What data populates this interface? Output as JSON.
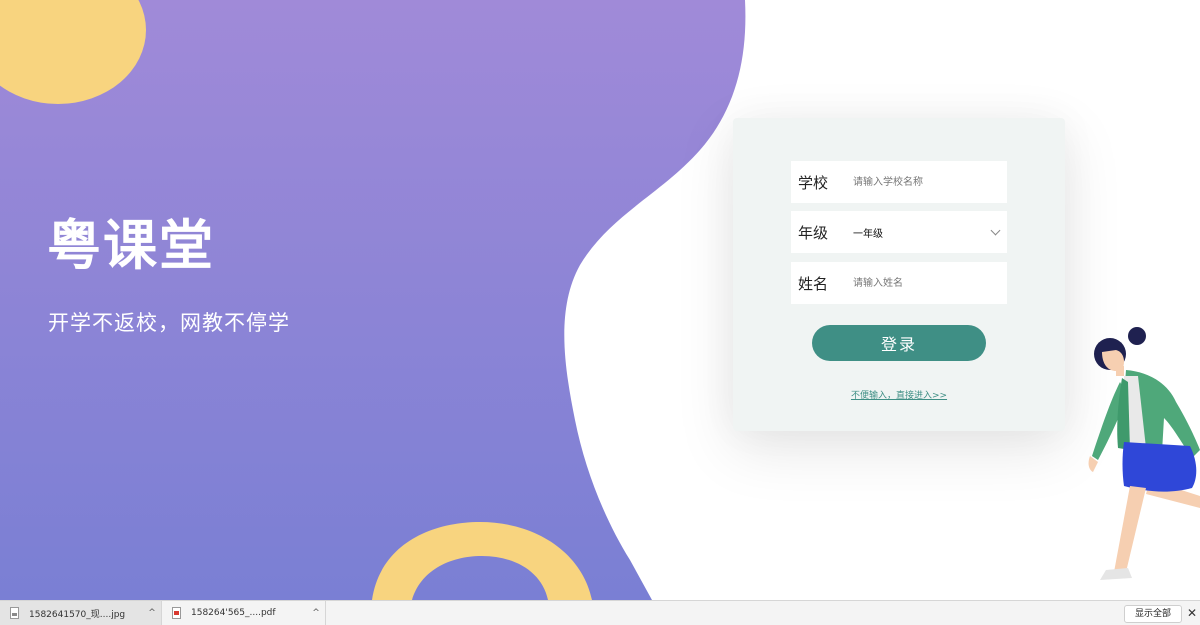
{
  "brand": {
    "title": "粤课堂",
    "slogan": "开学不返校，网教不停学"
  },
  "colors": {
    "purple_top": "#a08ad8",
    "purple_bottom": "#7a7fd4",
    "yellow_accent": "#f8d47f",
    "button_teal": "#3f8f85",
    "card_bg": "#f0f4f3"
  },
  "login": {
    "school_label": "学校",
    "school_placeholder": "请输入学校名称",
    "grade_label": "年级",
    "grade_value": "一年级",
    "name_label": "姓名",
    "name_placeholder": "请输入姓名",
    "submit_label": "登录",
    "skip_link": "不便输入，直接进入>>"
  },
  "download_bar": {
    "items": [
      {
        "name": "1582641570_现....jpg",
        "icon": "jpg-file-icon"
      },
      {
        "name": "158264'565_....pdf",
        "icon": "pdf-file-icon"
      }
    ],
    "caret": "^",
    "show_all_label": "显示全部",
    "close_label": "✕"
  },
  "illustration": {
    "icon": "walking-woman-illustration"
  }
}
